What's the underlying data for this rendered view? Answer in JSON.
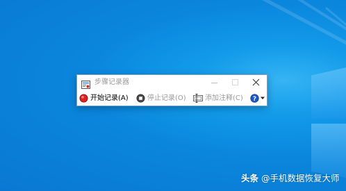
{
  "window": {
    "title": "步骤记录器"
  },
  "toolbar": {
    "start_label": "开始记录(A)",
    "stop_label": "停止记录(O)",
    "comment_label": "添加注释(C)"
  },
  "icons": {
    "app": "steps-recorder-icon",
    "record": "record-icon",
    "stop": "stop-icon",
    "comment": "comment-icon",
    "help": "help-icon",
    "dropdown": "chevron-down-icon"
  },
  "watermark": {
    "prefix": "头条",
    "handle": "@手机数据恢复大师"
  },
  "colors": {
    "desktop": "#0a86dc",
    "record": "#e02020",
    "help": "#1a56c8",
    "disabled_text": "#9a9a9a"
  }
}
